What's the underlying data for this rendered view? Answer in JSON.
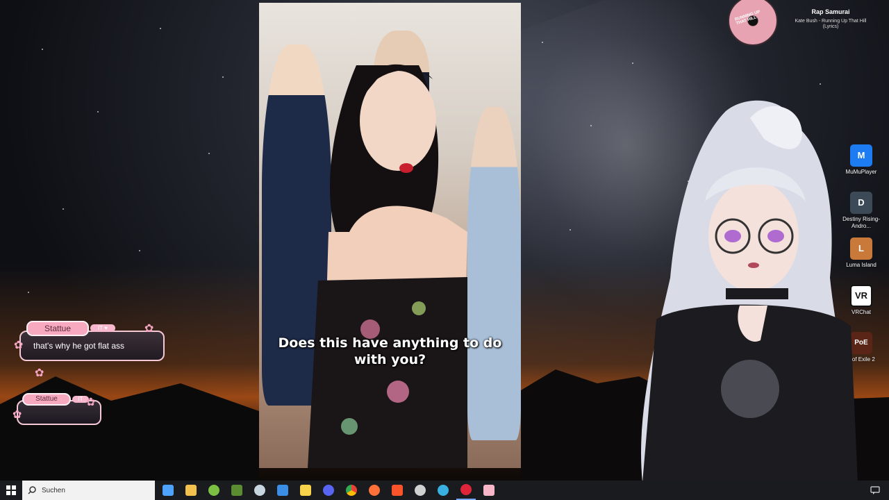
{
  "desktop": {
    "icons": [
      {
        "label": "MuMuPlayer",
        "color": "#1e7cf2",
        "glyph": "M"
      },
      {
        "label": "Destiny Rising-Andro...",
        "color": "#3c4a58",
        "glyph": "D"
      },
      {
        "label": "Luma Island",
        "color": "#c97a3a",
        "glyph": "L"
      },
      {
        "label": "VRChat",
        "color": "#ffffff",
        "glyph": "VR"
      },
      {
        "label": "n of Exile 2",
        "color": "#5a2416",
        "glyph": "PoE"
      }
    ]
  },
  "video": {
    "subtitle": "Does this have anything to do with you?"
  },
  "music": {
    "title": "Rap Samurai",
    "subtitle": "Kate Bush - Running Up That Hill (Lyrics)",
    "disc_text": "RUNNING UP THAT HILL"
  },
  "chat": [
    {
      "name": "Stattue",
      "message": "that's why he got flat ass",
      "badge": "IT ♥"
    },
    {
      "name": "Stattue",
      "message": "",
      "badge": "IT"
    }
  ],
  "taskbar": {
    "search_placeholder": "Suchen",
    "apps": [
      {
        "name": "widgets-icon",
        "color": "#4ea3ff"
      },
      {
        "name": "file-explorer-icon",
        "color": "#f2c14e"
      },
      {
        "name": "android-icon",
        "color": "#7bc043"
      },
      {
        "name": "minecraft-icon",
        "color": "#5b8c32"
      },
      {
        "name": "steam-icon",
        "color": "#c7d5e0"
      },
      {
        "name": "window-icon",
        "color": "#3a8ee6"
      },
      {
        "name": "g-app-icon",
        "color": "#f7d24b"
      },
      {
        "name": "discord-icon",
        "color": "#5865f2"
      },
      {
        "name": "chrome-icon",
        "color": "#e94235"
      },
      {
        "name": "firefox-icon",
        "color": "#ff7139"
      },
      {
        "name": "brave-icon",
        "color": "#fb542b"
      },
      {
        "name": "obs-icon",
        "color": "#d0d0d0"
      },
      {
        "name": "swirl-app-icon",
        "color": "#3ab0e2"
      },
      {
        "name": "opera-icon",
        "color": "#e0243a"
      },
      {
        "name": "pink-app-icon",
        "color": "#f6b6c8"
      }
    ]
  }
}
